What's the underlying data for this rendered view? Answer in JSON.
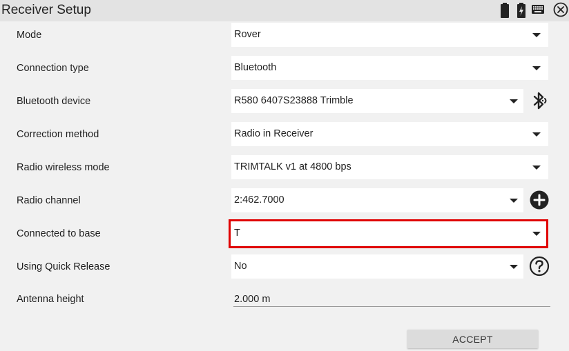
{
  "window": {
    "title": "Receiver Setup",
    "icons": [
      "battery-icon",
      "battery-charging-icon",
      "keyboard-icon",
      "close-icon"
    ]
  },
  "form": {
    "rows": [
      {
        "label": "Mode",
        "value": "Rover",
        "type": "dropdown"
      },
      {
        "label": "Connection type",
        "value": "Bluetooth",
        "type": "dropdown"
      },
      {
        "label": "Bluetooth device",
        "value": "R580 6407S23888 Trimble",
        "type": "dropdown",
        "side_icon": "bluetooth-search-icon"
      },
      {
        "label": "Correction method",
        "value": "Radio in Receiver",
        "type": "dropdown"
      },
      {
        "label": "Radio wireless mode",
        "value": "TRIMTALK v1 at 4800 bps",
        "type": "dropdown"
      },
      {
        "label": "Radio channel",
        "value": "2:462.7000",
        "type": "dropdown",
        "side_icon": "add-icon"
      },
      {
        "label": "Connected to base",
        "value": "T",
        "type": "dropdown",
        "highlighted": true,
        "highlight_color": "#e00000"
      },
      {
        "label": "Using Quick Release",
        "value": "No",
        "type": "dropdown",
        "side_icon": "help-icon"
      },
      {
        "label": "Antenna height",
        "value": "2.000 m",
        "type": "text"
      }
    ]
  },
  "actions": {
    "accept_label": "ACCEPT"
  },
  "colors": {
    "background": "#f1f1f1",
    "titlebar": "#e3e3e3",
    "field": "#ffffff",
    "highlight": "#e00000",
    "accept_button": "#dcdcdc"
  }
}
